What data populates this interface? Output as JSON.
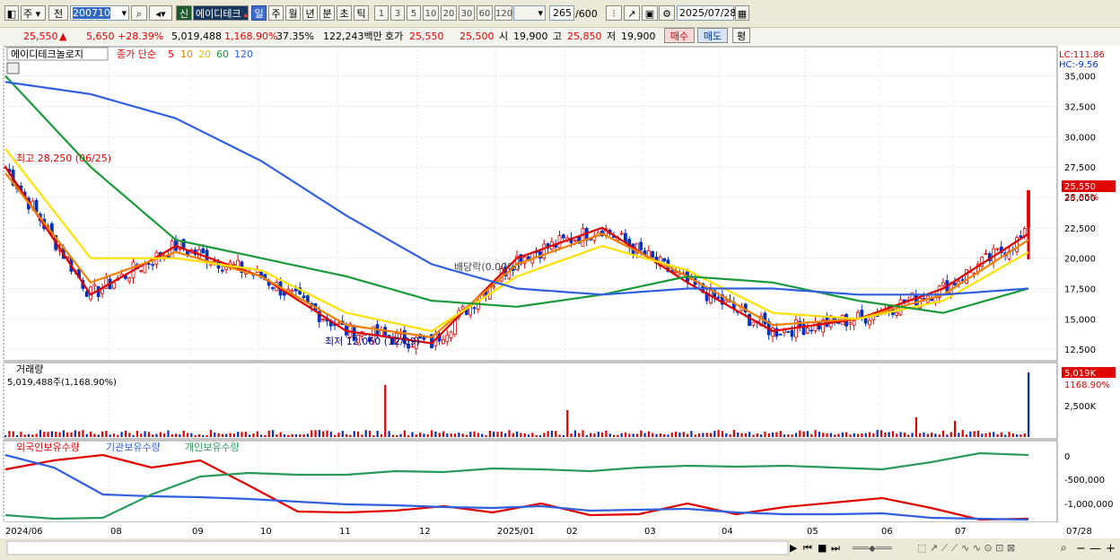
{
  "toolbar": {
    "period_left": "주",
    "prev_label": "전",
    "code": "200710",
    "new_badge": "신",
    "stock_name": "에이디테크",
    "periods": [
      "일",
      "주",
      "월",
      "년",
      "분",
      "초",
      "틱"
    ],
    "active_period": "일",
    "numbers": [
      "1",
      "3",
      "5",
      "10",
      "20",
      "30",
      "60",
      "120"
    ],
    "count": "265",
    "total": "/600",
    "date": "2025/07/28"
  },
  "quote": {
    "price": "25,550",
    "arrow": "▲",
    "change": "5,650",
    "change_pct": "+28.39%",
    "volume": "5,019,488",
    "volume_pct": "1,168.90%",
    "turnover": "37.35%",
    "amount": "122,243백만",
    "hoga_label": "호가",
    "ask": "25,550",
    "bid": "25,500",
    "open_label": "시",
    "open": "19,900",
    "high_label": "고",
    "high": "25,850",
    "low_label": "저",
    "low": "19,900",
    "buy_label": "매수",
    "sell_label": "매도",
    "avg_label": "평"
  },
  "main_chart": {
    "title": "에이디테크놀로지",
    "ma_label": "종가 단순",
    "ma_periods": [
      "5",
      "10",
      "20",
      "60",
      "120"
    ],
    "lc": "LC:111.86",
    "hc": "HC:-9.56",
    "y_ticks": [
      "35,000",
      "32,500",
      "30,000",
      "27,500",
      "25,000",
      "22,500",
      "20,000",
      "17,500",
      "15,000",
      "12,500"
    ],
    "current_price_label": "25,550",
    "current_pct_label": "28.85%",
    "high_annotation": "최고 28,250 (06/25)",
    "low_annotation": "최저 12,060 (12/09)",
    "dividend_annotation": "배당락(0.00%)"
  },
  "volume_chart": {
    "title": "거래량",
    "value_text": "5,019,488주(1,168.90%)",
    "current_label": "5,019K",
    "current_pct": "1168.90%",
    "y_ticks": [
      "2,500K"
    ]
  },
  "holding_chart": {
    "series_labels": [
      "외국인보유수량",
      "기관보유수량",
      "개인보유수량"
    ],
    "y_ticks": [
      "0",
      "-500,000",
      "-1,000,000"
    ]
  },
  "x_axis": [
    "2024/06",
    "08",
    "09",
    "10",
    "11",
    "12",
    "2025/01",
    "02",
    "03",
    "04",
    "05",
    "06",
    "07",
    "07/28"
  ],
  "colors": {
    "ma5": "#e00000",
    "ma10": "#f08000",
    "ma20": "#ffe000",
    "ma60": "#1a9a3a",
    "ma120": "#3060e0",
    "up": "#e00000",
    "down": "#0030c0",
    "foreign": "#e00000",
    "institution": "#3060e0",
    "individual": "#2a9a5a"
  },
  "chart_data": {
    "type": "line",
    "x": [
      "2024/06",
      "08",
      "09",
      "10",
      "11",
      "12",
      "2025/01",
      "02",
      "03",
      "04",
      "05",
      "06",
      "07"
    ],
    "series": [
      {
        "name": "5",
        "values": [
          27500,
          17000,
          21000,
          18500,
          14000,
          13000,
          20000,
          22500,
          18000,
          14000,
          15000,
          17500,
          22000
        ]
      },
      {
        "name": "10",
        "values": [
          27000,
          18000,
          20500,
          18500,
          14500,
          13500,
          19500,
          22000,
          18500,
          14500,
          15000,
          17000,
          21500
        ]
      },
      {
        "name": "20",
        "values": [
          29000,
          20000,
          20000,
          19000,
          15500,
          14000,
          18500,
          21000,
          19000,
          15500,
          15000,
          16500,
          20500
        ]
      },
      {
        "name": "60",
        "values": [
          35000,
          27500,
          21500,
          20000,
          18500,
          16500,
          16000,
          17000,
          18500,
          18000,
          16500,
          15500,
          17500
        ]
      },
      {
        "name": "120",
        "values": [
          34500,
          33500,
          31500,
          28000,
          23500,
          19500,
          17500,
          17000,
          17500,
          17500,
          17000,
          17000,
          17500
        ]
      }
    ],
    "ylim": [
      12000,
      36000
    ]
  }
}
